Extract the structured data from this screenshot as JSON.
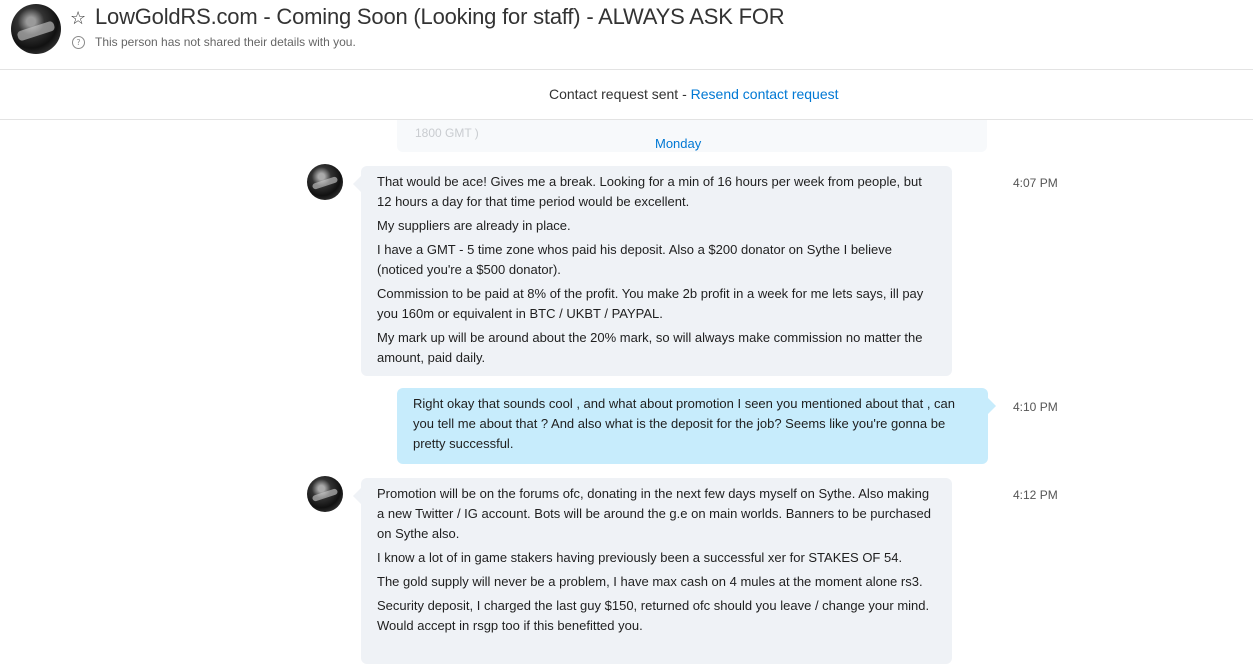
{
  "header": {
    "title": "LowGoldRS.com - Coming Soon (Looking for staff) - ALWAYS ASK FOR",
    "subtitle": "This person has not shared their details with you.",
    "info_glyph": "?"
  },
  "contact_bar": {
    "text": "Contact request sent - ",
    "link": "Resend contact request"
  },
  "faded_message": "1800 GMT )",
  "day_separator": "Monday",
  "messages": [
    {
      "time": "4:07 PM",
      "paragraphs": [
        "That would be ace! Gives me a break. Looking for a min of 16 hours per week from people, but 12 hours a day for that time period would be excellent.",
        "My suppliers are already in place.",
        "I have a GMT - 5 time zone whos paid his deposit. Also a $200 donator on Sythe I believe (noticed you're a $500 donator).",
        "Commission to be paid at 8% of the profit. You make 2b profit in a week for me lets says, ill pay you 160m or equivalent in BTC / UKBT / PAYPAL.",
        "My mark up will be around about the 20% mark, so will always make commission no matter the amount, paid daily."
      ]
    },
    {
      "time": "4:10 PM",
      "paragraphs": [
        "Right okay that sounds cool , and what about promotion I seen you mentioned about that , can you tell me about that ? And also what is the deposit for the job? Seems like you're gonna be pretty successful."
      ]
    },
    {
      "time": "4:12 PM",
      "paragraphs": [
        "Promotion will be on the forums ofc, donating in the next few days myself on Sythe. Also making a new Twitter / IG account. Bots will be around the g.e on main worlds. Banners to be purchased on Sythe also.",
        "I know a lot of in game stakers having previously been a successful xer for STAKES OF 54.",
        "The gold supply will never be a problem, I have max cash on 4 mules at the moment alone rs3.",
        "Security deposit, I charged the last guy $150, returned ofc should you leave / change your mind. Would accept in rsgp too if this benefitted you."
      ]
    }
  ]
}
